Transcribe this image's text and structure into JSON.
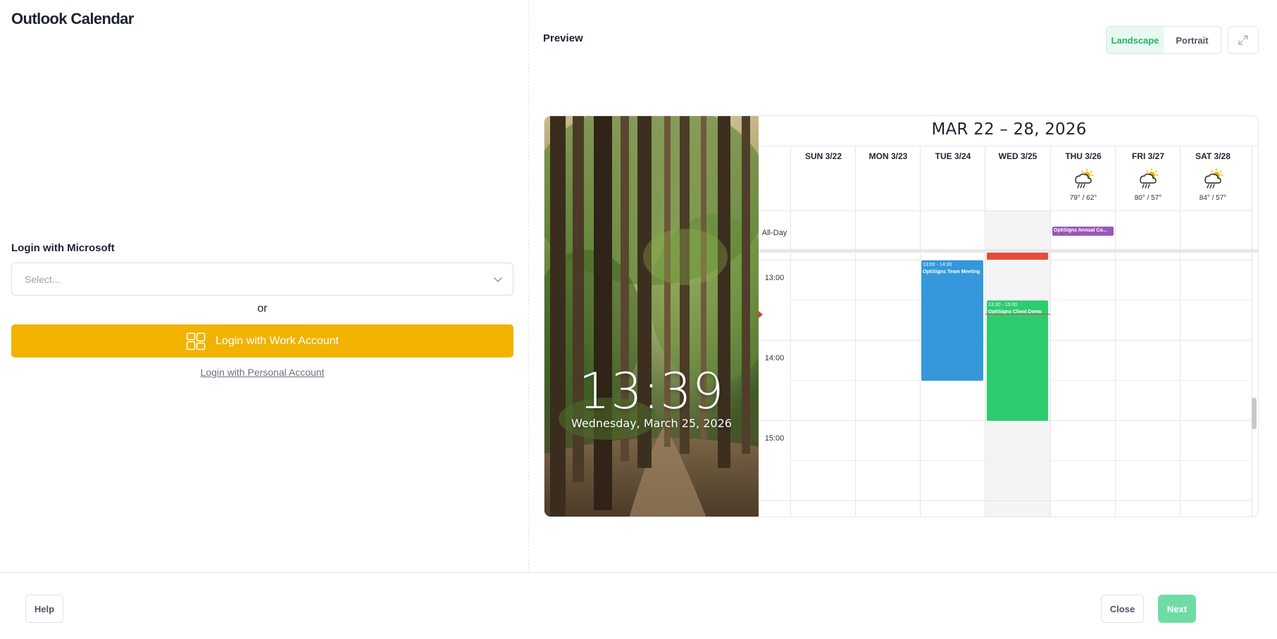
{
  "app": {
    "title": "Outlook Calendar"
  },
  "login": {
    "label": "Login with Microsoft",
    "select_placeholder": "Select...",
    "or": "or",
    "work_button": "Login with Work Account",
    "personal_link": "Login with Personal Account"
  },
  "preview": {
    "title": "Preview",
    "orientation": {
      "landscape": "Landscape",
      "portrait": "Portrait",
      "selected": "Landscape"
    },
    "clock": {
      "time": "13:39",
      "date": "Wednesday, March 25, 2026"
    },
    "calendar": {
      "range": "MAR 22 – 28, 2026",
      "days": [
        {
          "label": "SUN 3/22"
        },
        {
          "label": "MON 3/23"
        },
        {
          "label": "TUE 3/24"
        },
        {
          "label": "WED 3/25",
          "today": true
        },
        {
          "label": "THU 3/26",
          "weather": "79° / 62°",
          "icon": "rain-sun-icon"
        },
        {
          "label": "FRI 3/27",
          "weather": "80° / 57°",
          "icon": "rain-sun-icon"
        },
        {
          "label": "SAT 3/28",
          "weather": "84° / 57°",
          "icon": "rain-sun-icon"
        }
      ],
      "allday_label": "All-Day",
      "times": [
        "13:00",
        "14:00",
        "15:00"
      ],
      "events": [
        {
          "day": "THU 3/26",
          "allday": true,
          "name": "OptiSigns Annual Co...",
          "color": "#9b59b6"
        },
        {
          "day": "WED 3/25",
          "name": "",
          "color": "#e74c3c"
        },
        {
          "day": "TUE 3/24",
          "time": "13:00 - 14:30",
          "name": "OptiSigns Team Meeting",
          "color": "#3498db"
        },
        {
          "day": "WED 3/25",
          "time": "13:30 - 15:00",
          "name": "OptiSigns Client Demo",
          "color": "#2ecc71"
        }
      ]
    }
  },
  "footer": {
    "help": "Help",
    "close": "Close",
    "next": "Next"
  },
  "colors": {
    "accent_yellow": "#f2b200",
    "accent_green": "#20b46a",
    "next_green": "#6fdca6"
  }
}
